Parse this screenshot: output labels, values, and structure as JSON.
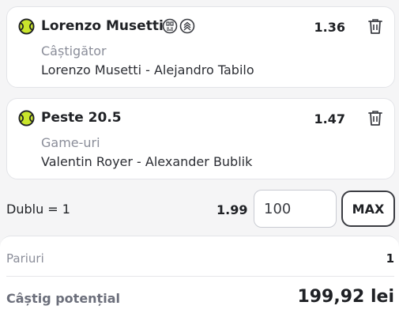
{
  "selections": [
    {
      "title": "Lorenzo Musetti",
      "odds": "1.36",
      "market": "Câștigător",
      "match": "Lorenzo Musetti - Alejandro Tabilo",
      "icons": [
        "tennis-ball-icon",
        "scoreboard-badge-icon",
        "streak-badge-icon",
        "trash-icon"
      ]
    },
    {
      "title": "Peste 20.5",
      "odds": "1.47",
      "market": "Game-uri",
      "match": "Valentin Royer - Alexander Bublik",
      "icons": [
        "tennis-ball-icon",
        "trash-icon"
      ]
    }
  ],
  "system": {
    "label": "Dublu = 1",
    "odds": "1.99",
    "stake_value": "100",
    "max_label": "MAX"
  },
  "summary": {
    "bets_label": "Pariuri",
    "bets_value": "1",
    "potential_label": "Câștig potențial",
    "potential_value": "199,92 lei"
  },
  "colors": {
    "ball": "#c9e52b",
    "text_primary": "#1f2125",
    "text_muted": "#8a8d99",
    "border": "#e3e4e8"
  }
}
